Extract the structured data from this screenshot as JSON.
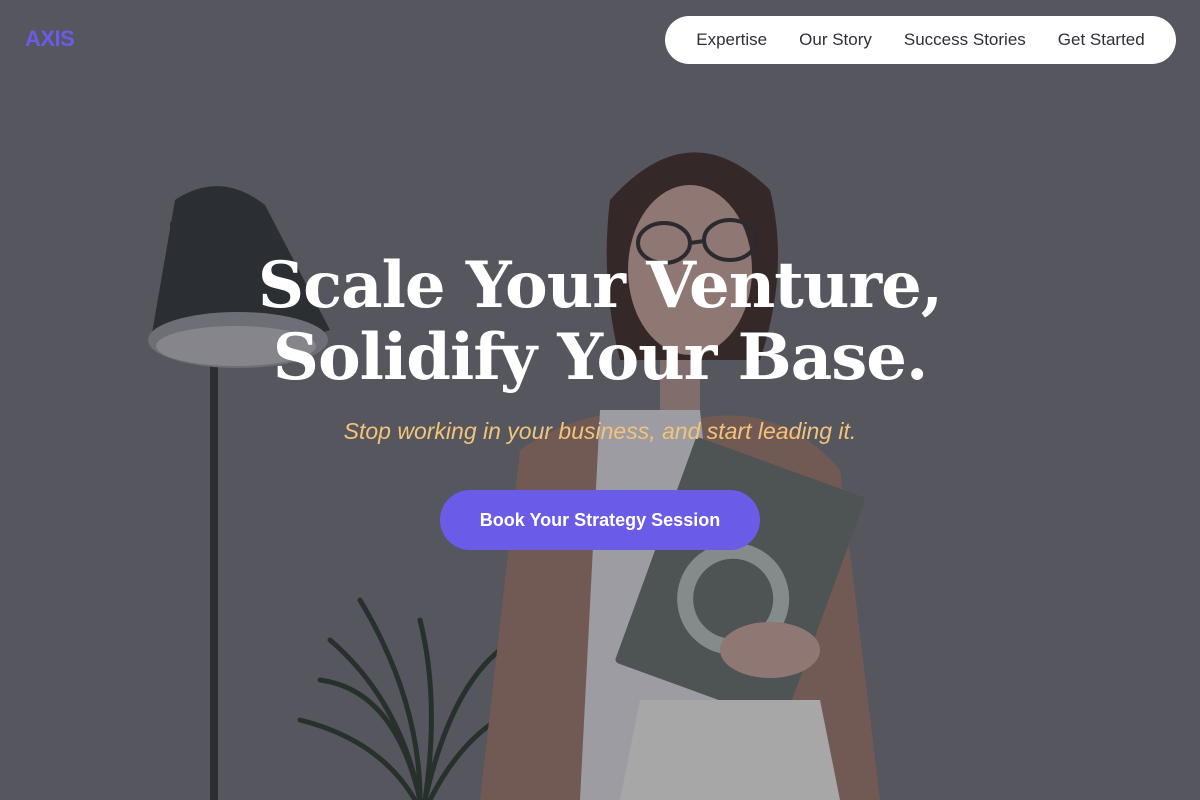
{
  "brand": {
    "logo": "AXIS",
    "accent": "#6a5ce6"
  },
  "nav": {
    "items": [
      {
        "label": "Expertise"
      },
      {
        "label": "Our Story"
      },
      {
        "label": "Success Stories"
      },
      {
        "label": "Get Started"
      }
    ]
  },
  "hero": {
    "headline_line1": "Scale Your Venture,",
    "headline_line2": "Solidify Your Base.",
    "subtitle": "Stop working in your business, and start leading it.",
    "subtitle_color": "#f3c37a",
    "cta_label": "Book Your Strategy Session",
    "background_image": "woman-with-book-photo"
  }
}
